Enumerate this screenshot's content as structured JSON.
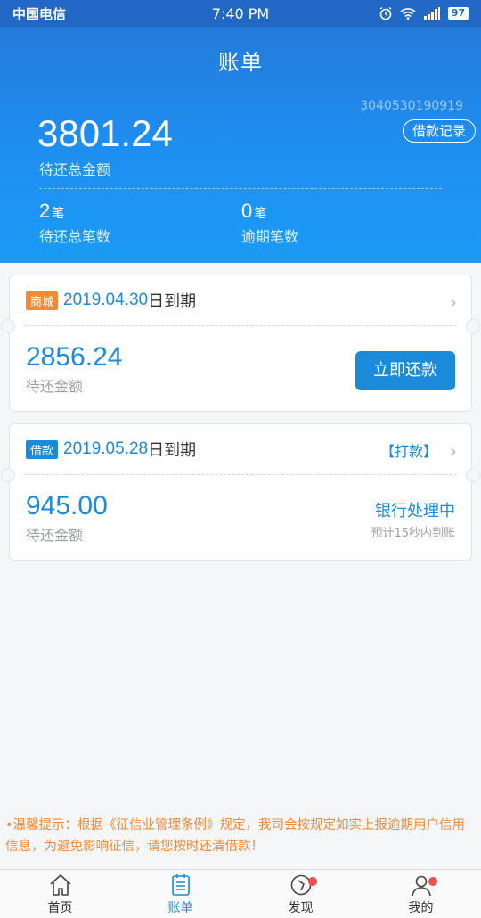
{
  "status_bar": {
    "carrier": "中国电信",
    "time": "7:40 PM",
    "battery": "97"
  },
  "header": {
    "title": "账单",
    "account_no": "3040530190919",
    "record_button": "借款记录",
    "total_amount": "3801.24",
    "total_label": "待还总金额",
    "pending_count": "2",
    "pending_unit": "笔",
    "pending_label": "待还总笔数",
    "overdue_count": "0",
    "overdue_unit": "笔",
    "overdue_label": "逾期笔数"
  },
  "bills": [
    {
      "tag": "商城",
      "date": "2019.04.30",
      "date_suffix": "日到期",
      "amount": "2856.24",
      "amount_label": "待还金额",
      "action": "立即还款"
    },
    {
      "tag": "借款",
      "date": "2019.05.28",
      "date_suffix": "日到期",
      "link": "【打款】",
      "amount": "945.00",
      "amount_label": "待还金额",
      "status": "银行处理中",
      "status_sub": "预计15秒内到账"
    }
  ],
  "notice": "•温馨提示：根据《征信业管理条例》规定，我司会按规定如实上报逾期用户信用信息，为避免影响征信，请您按时还清借款！",
  "nav": [
    {
      "label": "首页",
      "icon": "home-icon"
    },
    {
      "label": "账单",
      "icon": "bill-icon"
    },
    {
      "label": "发现",
      "icon": "compass-icon"
    },
    {
      "label": "我的",
      "icon": "user-icon"
    }
  ],
  "colors": {
    "brand": "#1b8ad8",
    "accent_orange": "#f48a33",
    "notice": "#f08a3a"
  }
}
